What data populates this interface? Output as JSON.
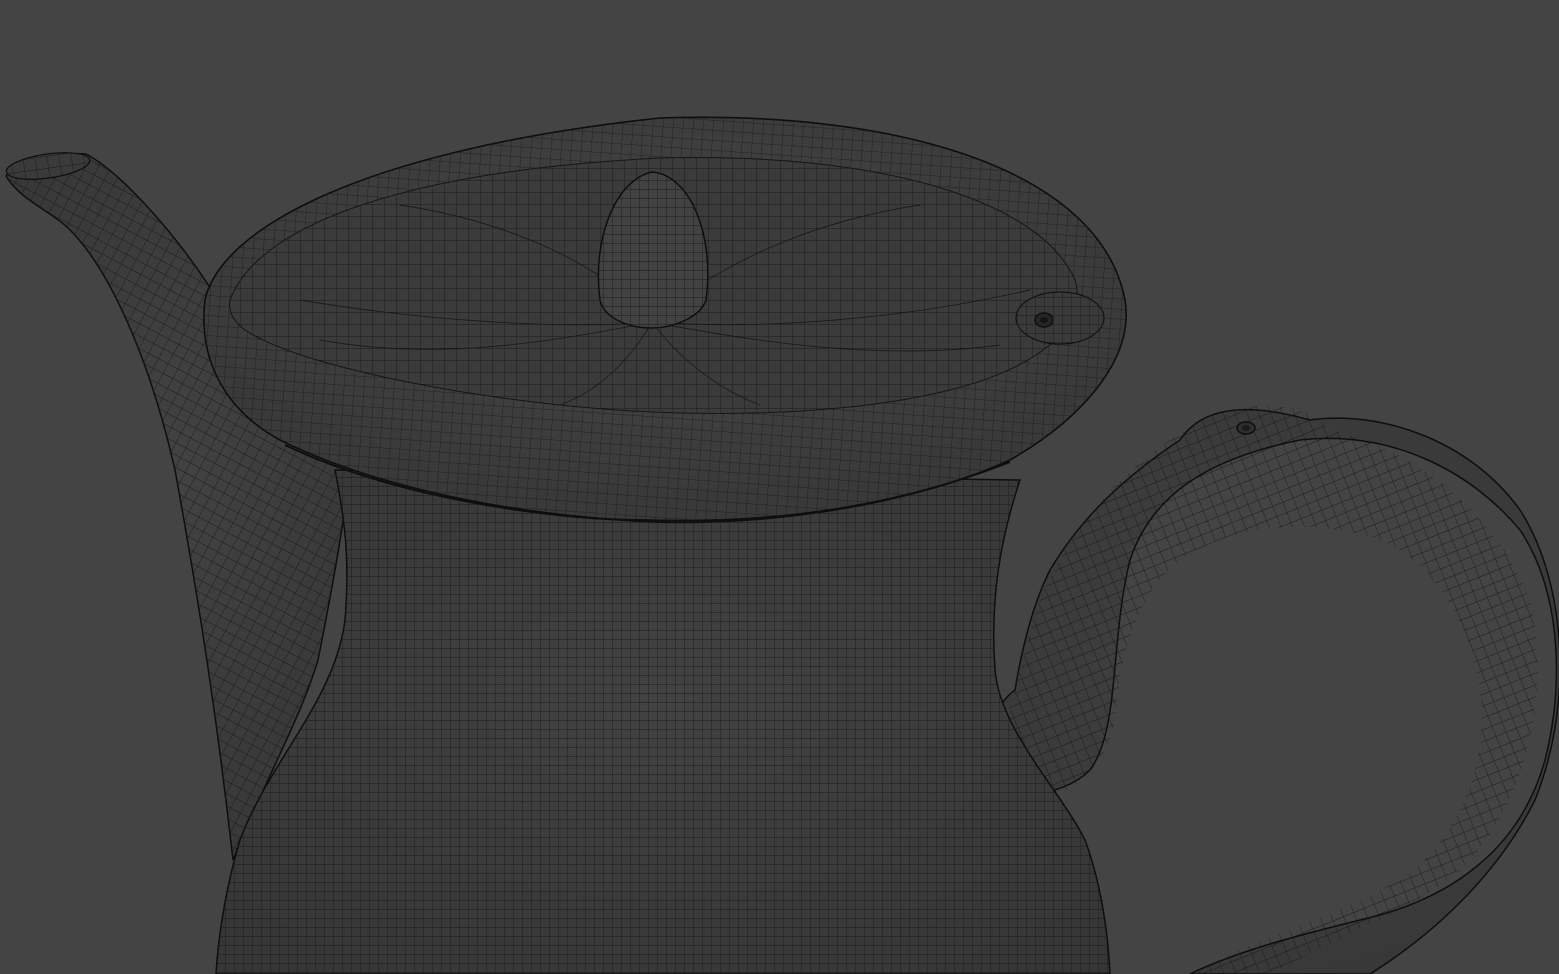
{
  "viewport": {
    "background_color": "#444444",
    "model": {
      "fill_color": "#3d3d3d",
      "shade_color": "#353535",
      "wire_color": "#141414",
      "edge_color": "#0e0e0e"
    }
  }
}
